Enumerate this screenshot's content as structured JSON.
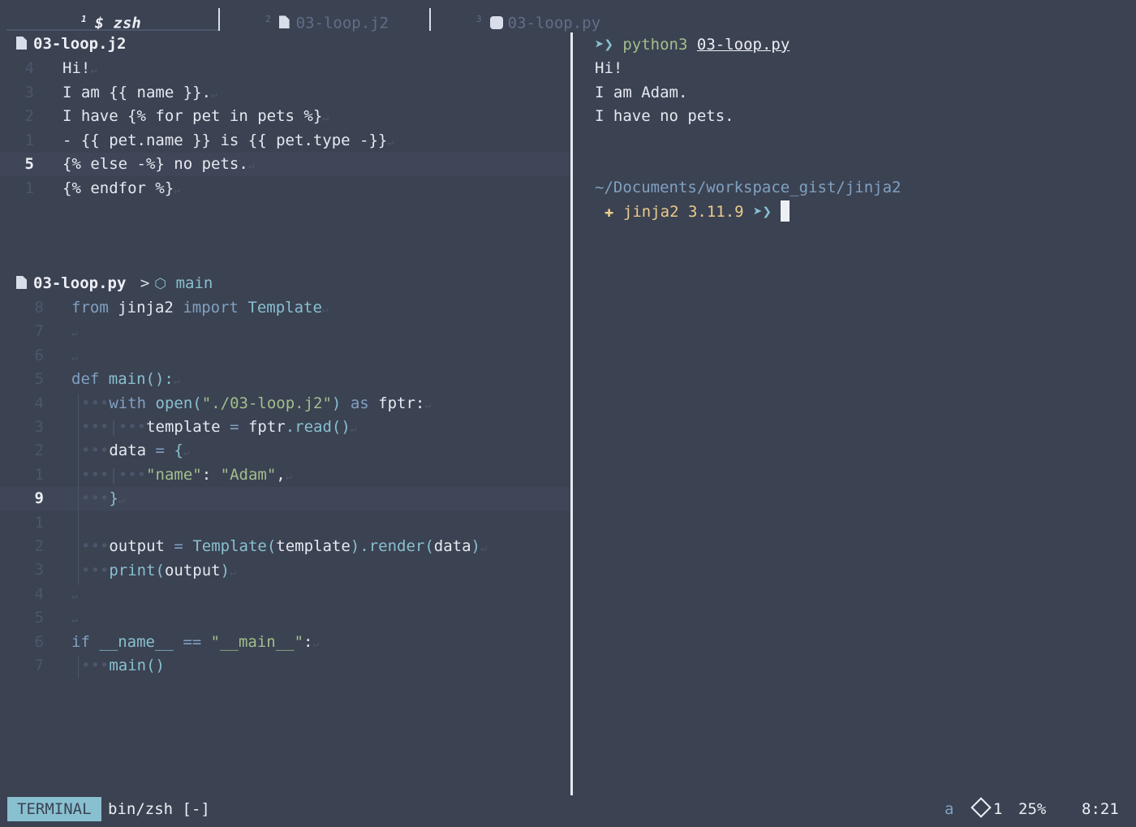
{
  "tabs": [
    {
      "num": "1",
      "icon": "dollar-icon",
      "label": "$ zsh",
      "active": true
    },
    {
      "num": "2",
      "icon": "file-icon",
      "label": "03-loop.j2",
      "active": false
    },
    {
      "num": "3",
      "icon": "python-icon",
      "label": "03-loop.py",
      "active": false
    }
  ],
  "j2_pane": {
    "title": "03-loop.j2",
    "line_numbers": [
      "4",
      "3",
      "2",
      "1",
      "5",
      "1"
    ],
    "current_line": "5",
    "lines": [
      "Hi!",
      "I am {{ name }}.",
      "I have {% for pet in pets %}",
      "- {{ pet.name }} is {{ pet.type -}}",
      "{% else -%} no pets.",
      "{% endfor %}"
    ]
  },
  "py_pane": {
    "title": "03-loop.py",
    "breadcrumb_sep": ">",
    "breadcrumb": "main",
    "line_numbers": [
      "8",
      "7",
      "6",
      "5",
      "4",
      "3",
      "2",
      "1",
      "9",
      "1",
      "2",
      "3",
      "4",
      "5",
      "6",
      "7"
    ],
    "current_line": "9",
    "code": {
      "l1_from": "from",
      "l1_mod": "jinja2",
      "l1_import": "import",
      "l1_cls": "Template",
      "l4_def": "def",
      "l4_name": "main():",
      "l5_with": "with",
      "l5_open": "open(",
      "l5_str": "\"./03-loop.j2\"",
      "l5_close": ")",
      "l5_as": "as",
      "l5_var": "fptr:",
      "l6_var": "template",
      "l6_eq": "=",
      "l6_obj": "fptr",
      "l6_call": ".read()",
      "l7_var": "data",
      "l7_eq": "=",
      "l7_brace": "{",
      "l8_key": "\"name\"",
      "l8_colon": ":",
      "l8_val": "\"Adam\"",
      "l8_comma": ",",
      "l9_brace": "}",
      "l11_var": "output",
      "l11_eq": "=",
      "l11_cls": "Template(",
      "l11_arg": "template",
      ")": ")",
      "l11_render": ".render(",
      "l11_data": "data",
      "l11_close": ")",
      "l12_print": "print(",
      "l12_arg": "output",
      "l12_close": ")",
      "l15_if": "if",
      "l15_name": "__name__",
      "l15_eq": "==",
      "l15_str": "\"__main__\"",
      "l15_colon": ":",
      "l16_call": "main()"
    }
  },
  "terminal": {
    "prompt_icon": "bird-icon",
    "command": "python3",
    "command_arg": "03-loop.py",
    "output": [
      "Hi!",
      "I am Adam.",
      "I have no pets."
    ],
    "cwd": "~/Documents/workspace_gist/jinja2",
    "venv_icon": "python-icon",
    "venv": "jinja2 3.11.9"
  },
  "statusbar": {
    "mode": "TERMINAL",
    "file": "bin/zsh [-]",
    "reg": "a",
    "cube_count": "1",
    "percent": "25%",
    "position": "8:21"
  },
  "colors": {
    "background": "#3b4252",
    "keyword": "#81a1c1",
    "function": "#88c0d0",
    "string": "#a3be8c",
    "venv": "#ebcb8b"
  }
}
